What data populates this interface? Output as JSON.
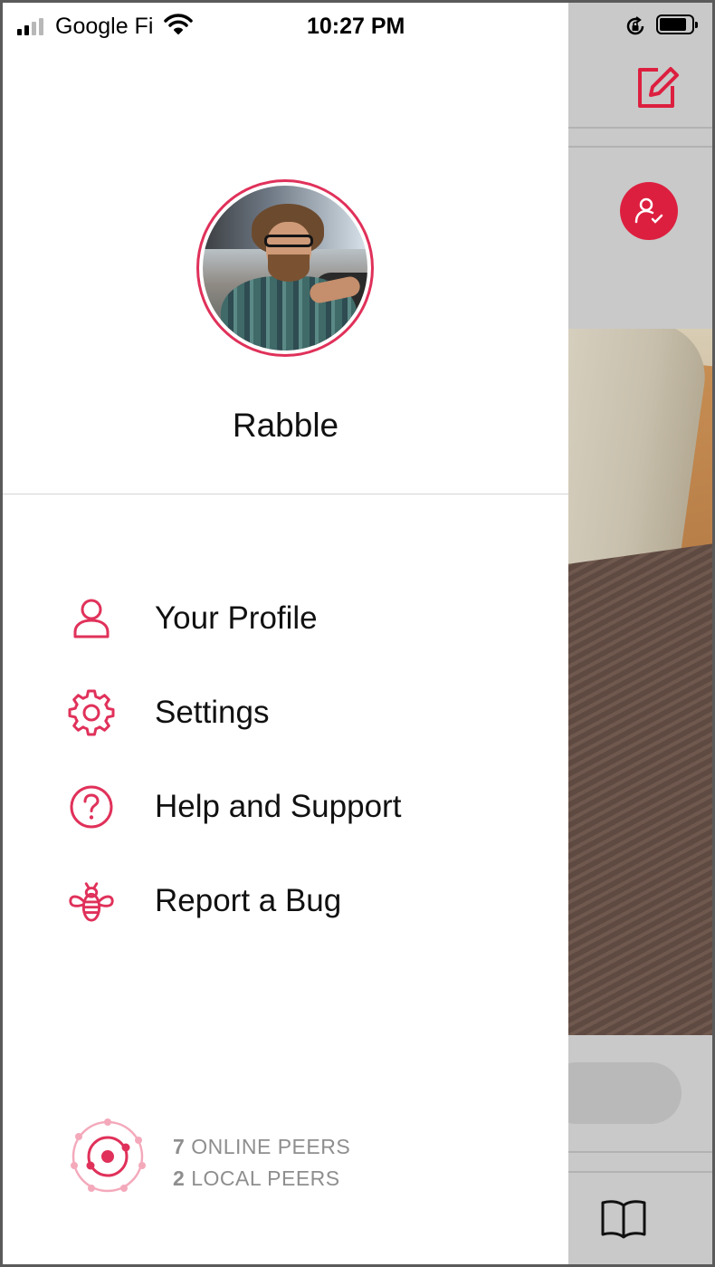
{
  "status_bar": {
    "carrier": "Google Fi",
    "time": "10:27 PM"
  },
  "drawer": {
    "username": "Rabble",
    "menu": [
      {
        "label": "Your Profile",
        "icon": "person-icon"
      },
      {
        "label": "Settings",
        "icon": "gear-icon"
      },
      {
        "label": "Help and Support",
        "icon": "question-icon"
      },
      {
        "label": "Report a Bug",
        "icon": "bug-icon"
      }
    ],
    "peers": {
      "online_count": "7",
      "online_label": "ONLINE PEERS",
      "local_count": "2",
      "local_label": "LOCAL PEERS"
    }
  },
  "colors": {
    "accent": "#e0315a",
    "badge_red": "#dd1f3f",
    "muted_text": "#8e8e8e"
  }
}
